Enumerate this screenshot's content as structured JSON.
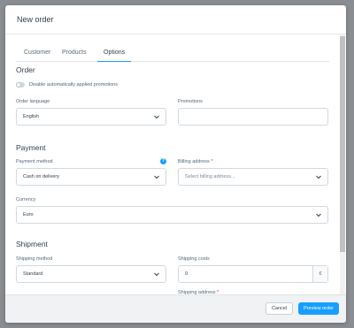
{
  "modal": {
    "title": "New order"
  },
  "tabs": [
    {
      "label": "Customer"
    },
    {
      "label": "Products"
    },
    {
      "label": "Options"
    }
  ],
  "order": {
    "title": "Order",
    "toggle_label": "Disable automatically applied promotions",
    "language": {
      "label": "Order language",
      "value": "English"
    },
    "promotions": {
      "label": "Promotions",
      "value": ""
    }
  },
  "payment": {
    "title": "Payment",
    "method": {
      "label": "Payment method",
      "value": "Cash on delivery",
      "help": "?"
    },
    "billing": {
      "label": "Billing address",
      "required": "*",
      "placeholder": "Select billing address..."
    },
    "currency": {
      "label": "Currency",
      "value": "Euro"
    }
  },
  "shipment": {
    "title": "Shipment",
    "method": {
      "label": "Shipping method",
      "value": "Standard"
    },
    "costs": {
      "label": "Shipping costs",
      "value": "0",
      "suffix": "€"
    },
    "address": {
      "label": "Shipping address",
      "required": "*"
    }
  },
  "footer": {
    "cancel_label": "Cancel",
    "preview_label": "Preview order"
  },
  "colors": {
    "accent": "#189eff",
    "required": "#de294c"
  }
}
